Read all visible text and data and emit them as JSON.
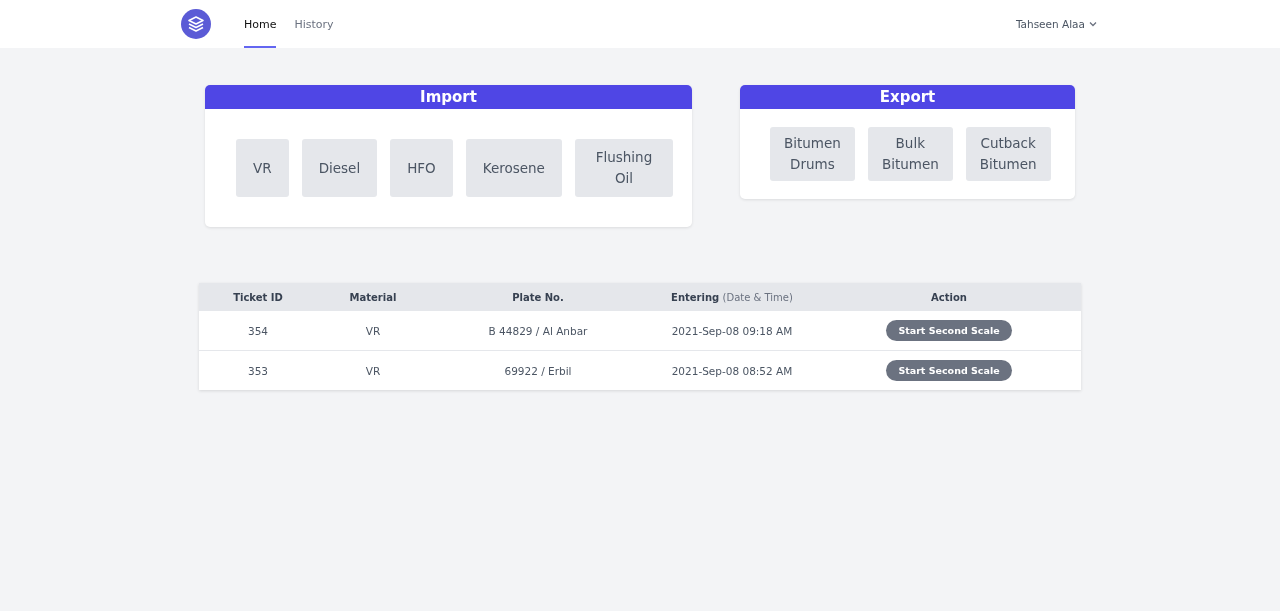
{
  "nav": {
    "tabs": [
      {
        "label": "Home",
        "selected": true
      },
      {
        "label": "History",
        "selected": false
      }
    ],
    "user": "Tahseen Alaa"
  },
  "cards": [
    {
      "title": "Import",
      "items": [
        "VR",
        "Diesel",
        "HFO",
        "Kerosene",
        "Flushing Oil"
      ]
    },
    {
      "title": "Export",
      "items": [
        "Bitumen Drums",
        "Bulk Bitumen",
        "Cutback Bitumen"
      ]
    }
  ],
  "table": {
    "columns": [
      {
        "label": "Ticket ID"
      },
      {
        "label": "Material"
      },
      {
        "label": "Plate No."
      },
      {
        "label": "Entering",
        "note": "(Date & Time)"
      },
      {
        "label": "Action"
      }
    ],
    "rows": [
      {
        "ticket": "354",
        "material": "VR",
        "plate": "B 44829 / Al Anbar",
        "entering": "2021-Sep-08 09:18 AM",
        "action": "Start Second Scale"
      },
      {
        "ticket": "353",
        "material": "VR",
        "plate": "69922 / Erbil",
        "entering": "2021-Sep-08 08:52 AM",
        "action": "Start Second Scale"
      }
    ]
  }
}
